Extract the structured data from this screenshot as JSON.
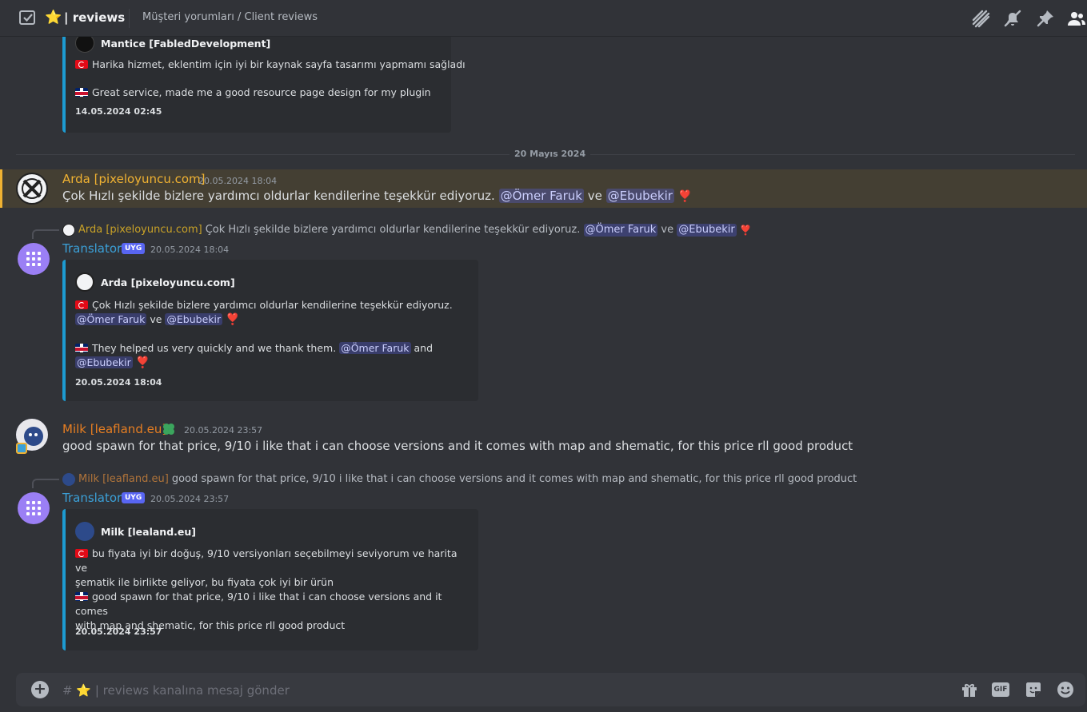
{
  "header": {
    "star": "⭐",
    "channel_name": "| reviews",
    "topic": "Müşteri yorumları / Client reviews",
    "icons": [
      "threads-icon",
      "notifications-muted-icon",
      "pin-icon",
      "member-list-icon"
    ]
  },
  "embed1": {
    "author": "Mantice [FabledDevelopment]",
    "tr_text": "Harika hizmet, eklentim için iyi bir kaynak sayfa tasarımı yapmamı sağladı",
    "en_text": "Great service, made me a good resource page design for my plugin",
    "timestamp": "14.05.2024 02:45"
  },
  "divider": {
    "label": "20 Mayıs 2024"
  },
  "msg_arda": {
    "username": "Arda [pixeloyuncu.com]",
    "timestamp": "20.05.2024 18:04",
    "text_pre": "Çok Hızlı şekilde bizlere yardımcı oldurlar kendilerine teşekkür ediyoruz.",
    "mention1": "@Ömer Faruk",
    "conj": "ve",
    "mention2": "@Ebubekir",
    "heart": "❣️"
  },
  "msg_translator1": {
    "reply_name": "Arda [pixeloyuncu.com]",
    "reply_text": "Çok Hızlı şekilde bizlere yardımcı oldurlar kendilerine teşekkür ediyoruz.",
    "reply_mention1": "@Ömer Faruk",
    "reply_conj": "ve",
    "reply_mention2": "@Ebubekir",
    "username": "Translator",
    "badge": "UYG",
    "timestamp": "20.05.2024 18:04",
    "embed": {
      "author": "Arda [pixeloyuncu.com]",
      "tr_text": "Çok Hızlı şekilde bizlere yardımcı oldurlar kendilerine teşekkür ediyoruz.",
      "tr_mention1": "@Ömer Faruk",
      "tr_conj": "ve",
      "tr_mention2": "@Ebubekir",
      "en_text": "They helped us very quickly and we thank them.",
      "en_mention1": "@Ömer Faruk",
      "en_conj": "and",
      "en_mention2": "@Ebubekir",
      "timestamp": "20.05.2024 18:04"
    }
  },
  "msg_milk": {
    "username": "Milk [leafland.eu]",
    "timestamp": "20.05.2024 23:57",
    "text": "good spawn for that price, 9/10 i like that i can choose versions and it comes with map and shematic, for this price rll good product"
  },
  "msg_translator2": {
    "reply_name": "Milk [leafland.eu]",
    "reply_text": "good spawn for that price, 9/10 i like that i can choose versions and it comes with map and shematic, for this price rll good product",
    "username": "Translator",
    "badge": "UYG",
    "timestamp": "20.05.2024 23:57",
    "embed": {
      "author": "Milk [lealand.eu]",
      "tr_line1": "bu fiyata iyi bir doğuş, 9/10 versiyonları seçebilmeyi seviyorum ve harita ve",
      "tr_line2": "şematik ile birlikte geliyor, bu fiyata çok iyi bir ürün",
      "en_line1": "good spawn for that price, 9/10 i like that i can choose versions and it comes",
      "en_line2": "with map and shematic, for this price rll good product",
      "timestamp": "20.05.2024 23:57"
    }
  },
  "composer": {
    "hash": "#",
    "star": "⭐",
    "placeholder": "| reviews kanalına mesaj gönder",
    "icons": [
      "gift-icon",
      "gif-icon",
      "sticker-icon",
      "emoji-icon"
    ],
    "gif_label": "GIF"
  },
  "colors": {
    "arda_name": "#f0b232",
    "translator_name": "#3ba0d8",
    "milk_name": "#e67e22",
    "embed_border": "#1d9bd1",
    "highlight_bg": "#443f33"
  }
}
